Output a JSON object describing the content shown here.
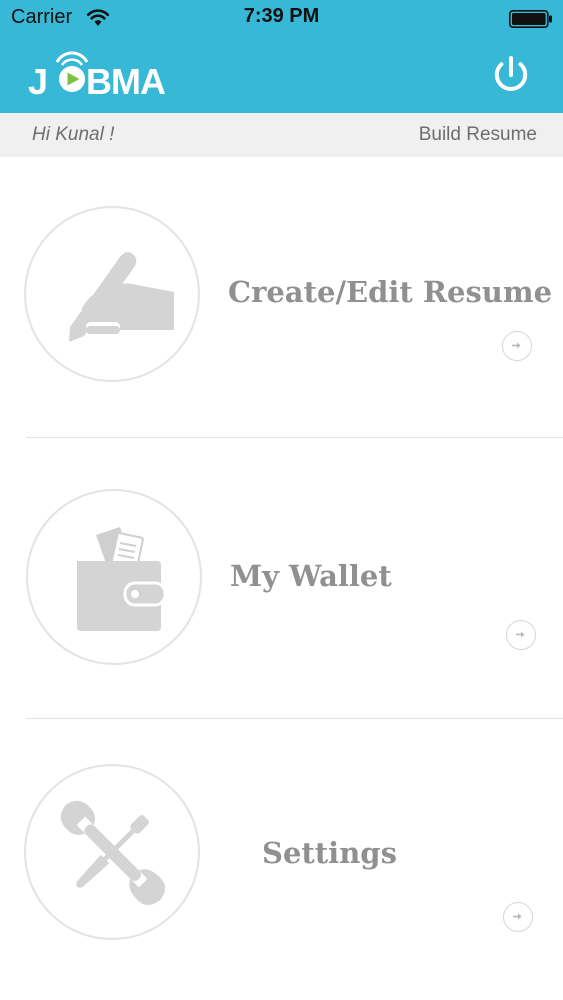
{
  "status_bar": {
    "carrier": "Carrier",
    "time": "7:39 PM",
    "wifi_icon": "wifi-icon",
    "battery_icon": "battery-icon"
  },
  "header": {
    "logo_text": "JOBMA",
    "power_icon": "power-icon",
    "background_color": "#37b8d6"
  },
  "subheader": {
    "greeting": "Hi Kunal !",
    "title": "Build Resume"
  },
  "menu": {
    "items": [
      {
        "label": "Create/Edit Resume",
        "icon": "pen-hand-icon"
      },
      {
        "label": "My Wallet",
        "icon": "wallet-icon"
      },
      {
        "label": "Settings",
        "icon": "tools-icon"
      }
    ],
    "arrow_icon": "arrow-right-icon"
  }
}
